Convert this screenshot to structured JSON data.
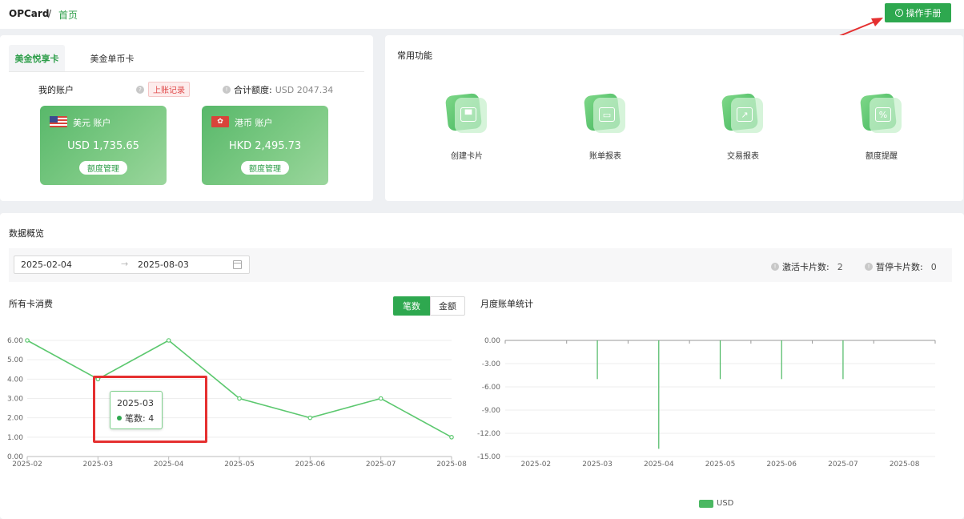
{
  "breadcrumb": {
    "root": "OPCard",
    "sep": "/",
    "home": "首页"
  },
  "header": {
    "manual_label": "操作手册"
  },
  "tabs": [
    "美金悦享卡",
    "美金单币卡"
  ],
  "accounts": {
    "title": "我的账户",
    "records_label": "上账记录",
    "total_label": "合计额度:",
    "total_value": "USD 2047.34",
    "items": [
      {
        "name": "美元 账户",
        "amount": "USD 1,735.65",
        "button": "额度管理",
        "flag": "us-flag-icon"
      },
      {
        "name": "港币 账户",
        "amount": "HKD 2,495.73",
        "button": "额度管理",
        "flag": "hk-flag-icon"
      }
    ]
  },
  "common": {
    "title": "常用功能",
    "items": [
      {
        "label": "创建卡片",
        "icon": "create-card-icon"
      },
      {
        "label": "账单报表",
        "icon": "bill-report-icon"
      },
      {
        "label": "交易报表",
        "icon": "transaction-report-icon"
      },
      {
        "label": "额度提醒",
        "icon": "limit-alert-icon"
      }
    ]
  },
  "overview": {
    "title": "数据概览",
    "date_start": "2025-02-04",
    "date_end": "2025-08-03",
    "active_label": "激活卡片数:",
    "active_value": "2",
    "paused_label": "暂停卡片数:",
    "paused_value": "0"
  },
  "charts": {
    "left_title": "所有卡消费",
    "toggle_count": "笔数",
    "toggle_amount": "金额",
    "right_title": "月度账单统计",
    "tooltip": {
      "date": "2025-03",
      "label": "笔数: 4"
    }
  },
  "chart_data": [
    {
      "type": "line",
      "title": "所有卡消费",
      "categories": [
        "2025-02",
        "2025-03",
        "2025-04",
        "2025-05",
        "2025-06",
        "2025-07",
        "2025-08"
      ],
      "series": [
        {
          "name": "笔数",
          "values": [
            6,
            4,
            6,
            3,
            2,
            3,
            1
          ]
        }
      ],
      "yticks": [
        "0.00",
        "1.00",
        "2.00",
        "3.00",
        "4.00",
        "5.00",
        "6.00"
      ],
      "ylim": [
        0,
        6
      ],
      "color": "#5cc86f",
      "grid": true
    },
    {
      "type": "bar",
      "title": "月度账单统计",
      "categories": [
        "2025-02",
        "2025-03",
        "2025-04",
        "2025-05",
        "2025-06",
        "2025-07",
        "2025-08"
      ],
      "series": [
        {
          "name": "USD",
          "values": [
            0,
            -5,
            -14,
            -5,
            -5,
            -5,
            0
          ]
        }
      ],
      "yticks": [
        "0.00",
        "-3.00",
        "-6.00",
        "-9.00",
        "-12.00",
        "-15.00"
      ],
      "ylim": [
        -15,
        0
      ],
      "color": "#4bb862",
      "legend": "bottom-center",
      "grid": true
    }
  ]
}
